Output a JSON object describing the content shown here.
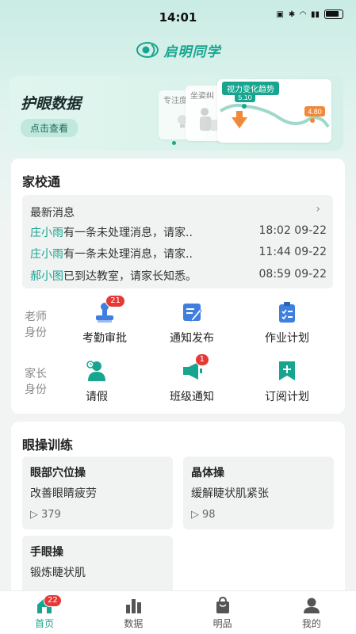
{
  "status_bar": {
    "time": "14:01"
  },
  "header": {
    "brand": "启明同学"
  },
  "banner": {
    "title": "护眼数据",
    "button": "点击查看",
    "mini_cards": [
      "专注度",
      "坐姿纠"
    ],
    "trend": {
      "title": "视力变化趋势",
      "point_start": "5.10",
      "point_end": "4.80"
    }
  },
  "home_school": {
    "title": "家校通",
    "latest_label": "最新消息",
    "messages": [
      {
        "name": "庄小雨",
        "text": "有一条未处理消息，请家...",
        "time": "18:02 09-22"
      },
      {
        "name": "庄小雨",
        "text": "有一条未处理消息，请家...",
        "time": "11:44 09-22"
      },
      {
        "name": "郝小图",
        "text": "已到达教室，请家长知悉。",
        "time": "08:59 09-22"
      }
    ],
    "teacher_role": "老师身份",
    "parent_role": "家长身份",
    "teacher_functions": [
      {
        "label": "考勤审批",
        "badge": "21",
        "icon": "attendance-stamp-icon"
      },
      {
        "label": "通知发布",
        "badge": "",
        "icon": "edit-document-icon"
      },
      {
        "label": "作业计划",
        "badge": "",
        "icon": "clipboard-icon"
      }
    ],
    "parent_functions": [
      {
        "label": "请假",
        "badge": "",
        "icon": "person-clock-icon"
      },
      {
        "label": "班级通知",
        "badge": "1",
        "icon": "megaphone-icon"
      },
      {
        "label": "订阅计划",
        "badge": "",
        "icon": "bookmark-plus-icon"
      }
    ]
  },
  "eye_exercise": {
    "title": "眼操训练",
    "items": [
      {
        "title": "眼部穴位操",
        "desc": "改善眼睛疲劳",
        "plays": "379"
      },
      {
        "title": "晶体操",
        "desc": "缓解睫状肌紧张",
        "plays": "98"
      },
      {
        "title": "手眼操",
        "desc": "锻炼睫状肌",
        "plays": ""
      }
    ]
  },
  "tabbar": {
    "tabs": [
      {
        "label": "首页",
        "badge": "22"
      },
      {
        "label": "数据"
      },
      {
        "label": "明品"
      },
      {
        "label": "我的"
      }
    ]
  },
  "colors": {
    "accent": "#18a58f",
    "badge": "#e53935",
    "icon_blue": "#3f7fe0"
  }
}
